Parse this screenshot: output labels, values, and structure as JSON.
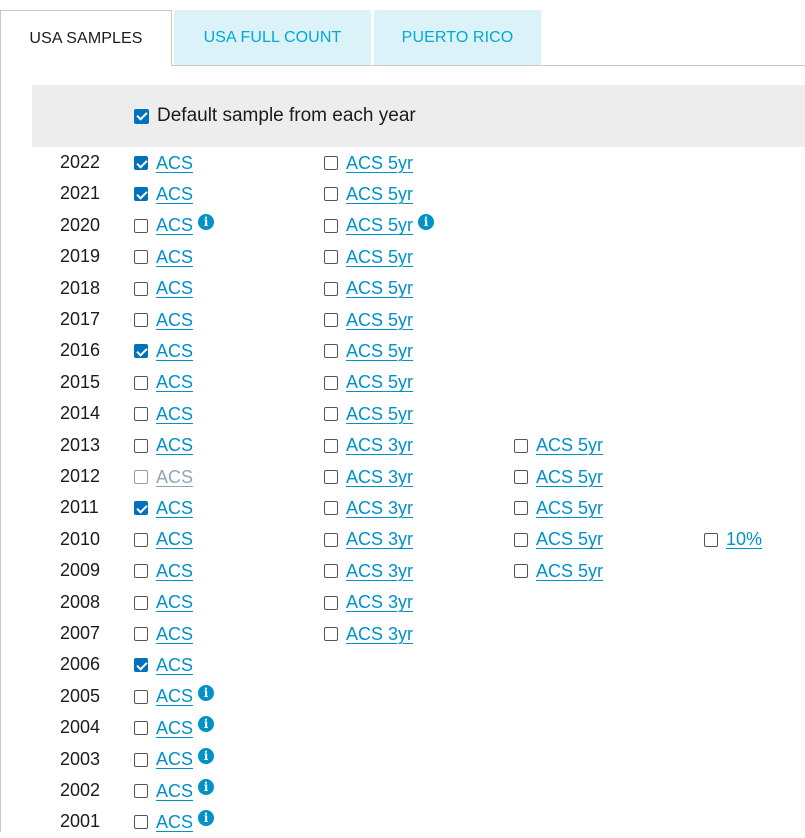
{
  "tabs": [
    {
      "label": "USA SAMPLES",
      "active": true
    },
    {
      "label": "USA FULL COUNT",
      "active": false
    },
    {
      "label": "PUERTO RICO",
      "active": false
    }
  ],
  "default_sample": {
    "label": "Default sample from each year",
    "checked": true
  },
  "colors": {
    "link": "#0091c9",
    "checkbox_checked": "#0071bc",
    "tab_inactive_bg": "#daf2f8",
    "tab_inactive_text": "#00a9d4",
    "bar_bg": "#ededed"
  },
  "years": [
    {
      "year": "2022",
      "samples": [
        {
          "col": 0,
          "label": "ACS",
          "checked": true
        },
        {
          "col": 1,
          "label": "ACS 5yr",
          "checked": false
        }
      ]
    },
    {
      "year": "2021",
      "samples": [
        {
          "col": 0,
          "label": "ACS",
          "checked": true
        },
        {
          "col": 1,
          "label": "ACS 5yr",
          "checked": false
        }
      ]
    },
    {
      "year": "2020",
      "samples": [
        {
          "col": 0,
          "label": "ACS",
          "checked": false,
          "info": true
        },
        {
          "col": 1,
          "label": "ACS 5yr",
          "checked": false,
          "info": true
        }
      ]
    },
    {
      "year": "2019",
      "samples": [
        {
          "col": 0,
          "label": "ACS",
          "checked": false
        },
        {
          "col": 1,
          "label": "ACS 5yr",
          "checked": false
        }
      ]
    },
    {
      "year": "2018",
      "samples": [
        {
          "col": 0,
          "label": "ACS",
          "checked": false
        },
        {
          "col": 1,
          "label": "ACS 5yr",
          "checked": false
        }
      ]
    },
    {
      "year": "2017",
      "samples": [
        {
          "col": 0,
          "label": "ACS",
          "checked": false
        },
        {
          "col": 1,
          "label": "ACS 5yr",
          "checked": false
        }
      ]
    },
    {
      "year": "2016",
      "samples": [
        {
          "col": 0,
          "label": "ACS",
          "checked": true
        },
        {
          "col": 1,
          "label": "ACS 5yr",
          "checked": false
        }
      ]
    },
    {
      "year": "2015",
      "samples": [
        {
          "col": 0,
          "label": "ACS",
          "checked": false
        },
        {
          "col": 1,
          "label": "ACS 5yr",
          "checked": false
        }
      ]
    },
    {
      "year": "2014",
      "samples": [
        {
          "col": 0,
          "label": "ACS",
          "checked": false
        },
        {
          "col": 1,
          "label": "ACS 5yr",
          "checked": false
        }
      ]
    },
    {
      "year": "2013",
      "samples": [
        {
          "col": 0,
          "label": "ACS",
          "checked": false
        },
        {
          "col": 1,
          "label": "ACS 3yr",
          "checked": false
        },
        {
          "col": 2,
          "label": "ACS 5yr",
          "checked": false
        }
      ]
    },
    {
      "year": "2012",
      "samples": [
        {
          "col": 0,
          "label": "ACS",
          "checked": false,
          "disabled": true
        },
        {
          "col": 1,
          "label": "ACS 3yr",
          "checked": false
        },
        {
          "col": 2,
          "label": "ACS 5yr",
          "checked": false
        }
      ]
    },
    {
      "year": "2011",
      "samples": [
        {
          "col": 0,
          "label": "ACS",
          "checked": true
        },
        {
          "col": 1,
          "label": "ACS 3yr",
          "checked": false
        },
        {
          "col": 2,
          "label": "ACS 5yr",
          "checked": false
        }
      ]
    },
    {
      "year": "2010",
      "samples": [
        {
          "col": 0,
          "label": "ACS",
          "checked": false
        },
        {
          "col": 1,
          "label": "ACS 3yr",
          "checked": false
        },
        {
          "col": 2,
          "label": "ACS 5yr",
          "checked": false
        },
        {
          "col": 3,
          "label": "10%",
          "checked": false
        }
      ]
    },
    {
      "year": "2009",
      "samples": [
        {
          "col": 0,
          "label": "ACS",
          "checked": false
        },
        {
          "col": 1,
          "label": "ACS 3yr",
          "checked": false
        },
        {
          "col": 2,
          "label": "ACS 5yr",
          "checked": false
        }
      ]
    },
    {
      "year": "2008",
      "samples": [
        {
          "col": 0,
          "label": "ACS",
          "checked": false
        },
        {
          "col": 1,
          "label": "ACS 3yr",
          "checked": false
        }
      ]
    },
    {
      "year": "2007",
      "samples": [
        {
          "col": 0,
          "label": "ACS",
          "checked": false
        },
        {
          "col": 1,
          "label": "ACS 3yr",
          "checked": false
        }
      ]
    },
    {
      "year": "2006",
      "samples": [
        {
          "col": 0,
          "label": "ACS",
          "checked": true
        }
      ]
    },
    {
      "year": "2005",
      "samples": [
        {
          "col": 0,
          "label": "ACS",
          "checked": false,
          "info": true
        }
      ]
    },
    {
      "year": "2004",
      "samples": [
        {
          "col": 0,
          "label": "ACS",
          "checked": false,
          "info": true
        }
      ]
    },
    {
      "year": "2003",
      "samples": [
        {
          "col": 0,
          "label": "ACS",
          "checked": false,
          "info": true
        }
      ]
    },
    {
      "year": "2002",
      "samples": [
        {
          "col": 0,
          "label": "ACS",
          "checked": false,
          "info": true
        }
      ]
    },
    {
      "year": "2001",
      "samples": [
        {
          "col": 0,
          "label": "ACS",
          "checked": false,
          "info": true
        }
      ]
    }
  ]
}
